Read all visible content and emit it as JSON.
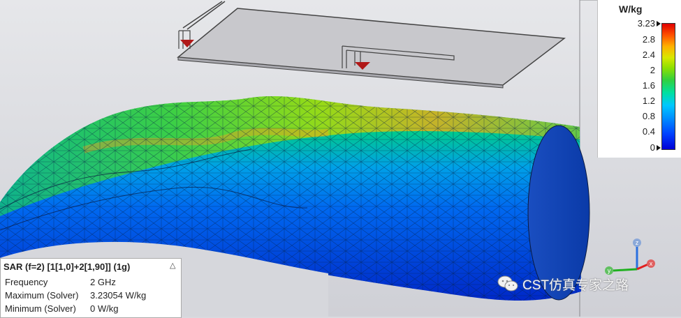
{
  "legend": {
    "unit": "W/kg",
    "ticks": [
      "3.23",
      "2.8",
      "2.4",
      "2",
      "1.6",
      "1.2",
      "0.8",
      "0.4",
      "0"
    ],
    "colors": {
      "max": "#e00000",
      "min": "#0000d6"
    }
  },
  "info": {
    "title": "SAR (f=2) [1[1,0]+2[1,90]] (1g)",
    "collapse_icon": "chevron-up-icon",
    "rows": [
      {
        "label": "Frequency",
        "value": "2 GHz"
      },
      {
        "label": "Maximum (Solver)",
        "value": "3.23054 W/kg"
      },
      {
        "label": "Minimum (Solver)",
        "value": "0 W/kg"
      }
    ]
  },
  "axes": {
    "z": "z",
    "y": "y",
    "x": "x"
  },
  "watermark": {
    "text": "CST仿真专家之路",
    "icon": "wechat-icon"
  }
}
